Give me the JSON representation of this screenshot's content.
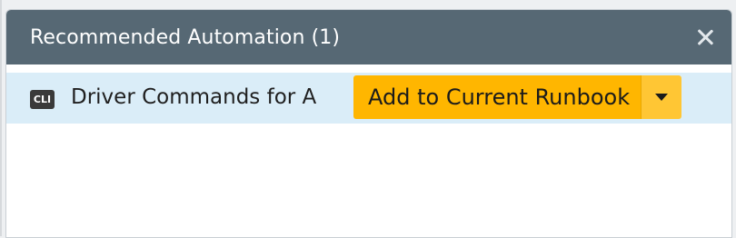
{
  "panel": {
    "title": "Recommended Automation (1)",
    "close_icon": "close-icon"
  },
  "rows": [
    {
      "icon": "cli-icon",
      "icon_text": "CLI",
      "name": "Driver Commands for A",
      "action": {
        "label": "Add to Current Runbook",
        "dropdown_icon": "chevron-down-icon"
      }
    }
  ],
  "colors": {
    "header_bg": "#566874",
    "row_bg": "#daedf8",
    "button_bg": "#ffb600",
    "button_toggle_bg": "#ffc634"
  }
}
